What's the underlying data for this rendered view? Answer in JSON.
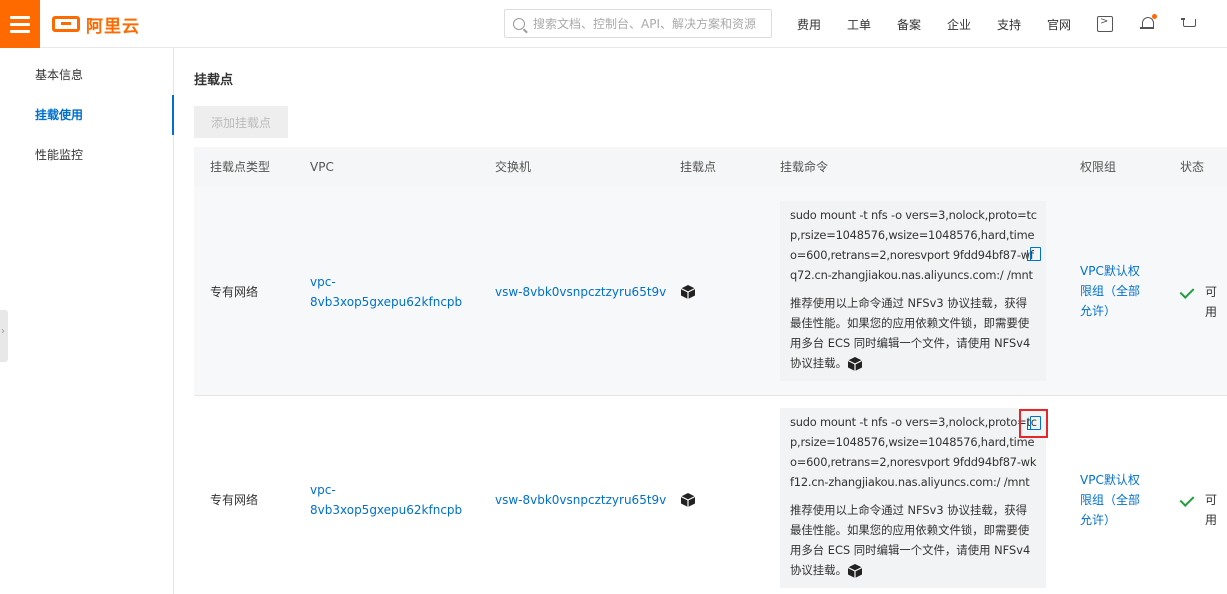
{
  "header": {
    "logo_text": "阿里云",
    "search": {
      "placeholder": "搜索文档、控制台、API、解决方案和资源"
    },
    "nav": [
      "费用",
      "工单",
      "备案",
      "企业",
      "支持",
      "官网"
    ],
    "icons": [
      "terminal-icon",
      "bell-icon",
      "cart-icon"
    ],
    "accent_color": "#ff6a00"
  },
  "sidebar": {
    "items": [
      {
        "label": "基本信息",
        "active": false
      },
      {
        "label": "挂载使用",
        "active": true
      },
      {
        "label": "性能监控",
        "active": false
      }
    ]
  },
  "main": {
    "section_title": "挂载点",
    "add_button": "添加挂载点",
    "table": {
      "columns": [
        "挂载点类型",
        "VPC",
        "交换机",
        "挂载点",
        "挂载命令",
        "权限组",
        "状态"
      ],
      "rows": [
        {
          "type": "专有网络",
          "vpc_line1": "vpc-",
          "vpc_line2": "8vb3xop5gxepu62kfncpb",
          "vswitch": "vsw-8vbk0vsnpcztzyru65t9v",
          "mount_cmd": "sudo mount -t nfs -o vers=3,nolock,proto=tcp,rsize=1048576,wsize=1048576,hard,timeo=600,retrans=2,noresvport 9fdd94bf87-wfq72.cn-zhangjiakou.nas.aliyuncs.com:/ /mnt",
          "note": "推荐使用以上命令通过 NFSv3 协议挂载，获得最佳性能。如果您的应用依赖文件锁，即需要使用多台 ECS 同时编辑一个文件，请使用 NFSv4 协议挂载。",
          "perm_line1": "VPC默认权",
          "perm_line2": "限组（全部",
          "perm_line3": "允许）",
          "status": "可用"
        },
        {
          "type": "专有网络",
          "vpc_line1": "vpc-",
          "vpc_line2": "8vb3xop5gxepu62kfncpb",
          "vswitch": "vsw-8vbk0vsnpcztzyru65t9v",
          "mount_cmd": "sudo mount -t nfs -o vers=3,nolock,proto=tcp,rsize=1048576,wsize=1048576,hard,timeo=600,retrans=2,noresvport 9fdd94bf87-wkf12.cn-zhangjiakou.nas.aliyuncs.com:/ /mnt",
          "note": "推荐使用以上命令通过 NFSv3 协议挂载，获得最佳性能。如果您的应用依赖文件锁，即需要使用多台 ECS 同时编辑一个文件，请使用 NFSv4 协议挂载。",
          "perm_line1": "VPC默认权",
          "perm_line2": "限组（全部",
          "perm_line3": "允许）",
          "status": "可用"
        }
      ]
    }
  }
}
